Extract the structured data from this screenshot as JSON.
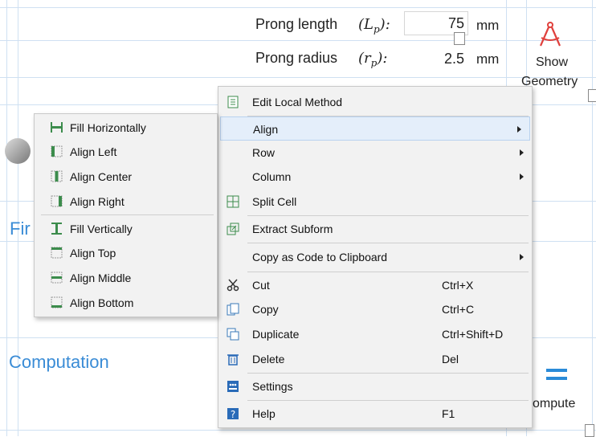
{
  "form": {
    "prong_length": {
      "label": "Prong length",
      "symbol": "(L",
      "sub": "p",
      "close": "):",
      "value": "75",
      "unit": "mm"
    },
    "prong_radius": {
      "label": "Prong radius",
      "symbol": "(r",
      "sub": "p",
      "close": "):",
      "value": "2.5",
      "unit": "mm"
    },
    "show_geometry_line1": "Show",
    "show_geometry_line2": "Geometry",
    "section_fin_partial": "Fir",
    "section_computation": "Computation",
    "compute_partial": "ompute"
  },
  "context_menu": {
    "items": [
      {
        "label": "Edit Local Method",
        "icon": "edit-method-icon"
      },
      {
        "label": "Align",
        "submenu": true,
        "highlighted": true
      },
      {
        "label": "Row",
        "submenu": true
      },
      {
        "label": "Column",
        "submenu": true
      },
      {
        "label": "Split Cell",
        "icon": "split-cell-icon"
      },
      {
        "label": "Extract Subform",
        "icon": "extract-subform-icon"
      },
      {
        "label": "Copy as Code to Clipboard",
        "submenu": true
      },
      {
        "label": "Cut",
        "shortcut": "Ctrl+X",
        "icon": "scissors-icon"
      },
      {
        "label": "Copy",
        "shortcut": "Ctrl+C",
        "icon": "copy-icon"
      },
      {
        "label": "Duplicate",
        "shortcut": "Ctrl+Shift+D",
        "icon": "duplicate-icon"
      },
      {
        "label": "Delete",
        "shortcut": "Del",
        "icon": "trash-icon"
      },
      {
        "label": "Settings",
        "icon": "settings-icon"
      },
      {
        "label": "Help",
        "shortcut": "F1",
        "icon": "help-icon"
      }
    ]
  },
  "align_submenu": {
    "items": [
      {
        "label": "Fill Horizontally",
        "icon": "fill-horizontally-icon"
      },
      {
        "label": "Align Left",
        "icon": "align-left-icon"
      },
      {
        "label": "Align Center",
        "icon": "align-center-icon"
      },
      {
        "label": "Align Right",
        "icon": "align-right-icon"
      },
      {
        "label": "Fill Vertically",
        "icon": "fill-vertically-icon"
      },
      {
        "label": "Align Top",
        "icon": "align-top-icon"
      },
      {
        "label": "Align Middle",
        "icon": "align-middle-icon"
      },
      {
        "label": "Align Bottom",
        "icon": "align-bottom-icon"
      }
    ]
  },
  "colors": {
    "accent": "#3a8cd6",
    "menu_bg": "#f2f2f2",
    "highlight": "#e4eefa"
  }
}
